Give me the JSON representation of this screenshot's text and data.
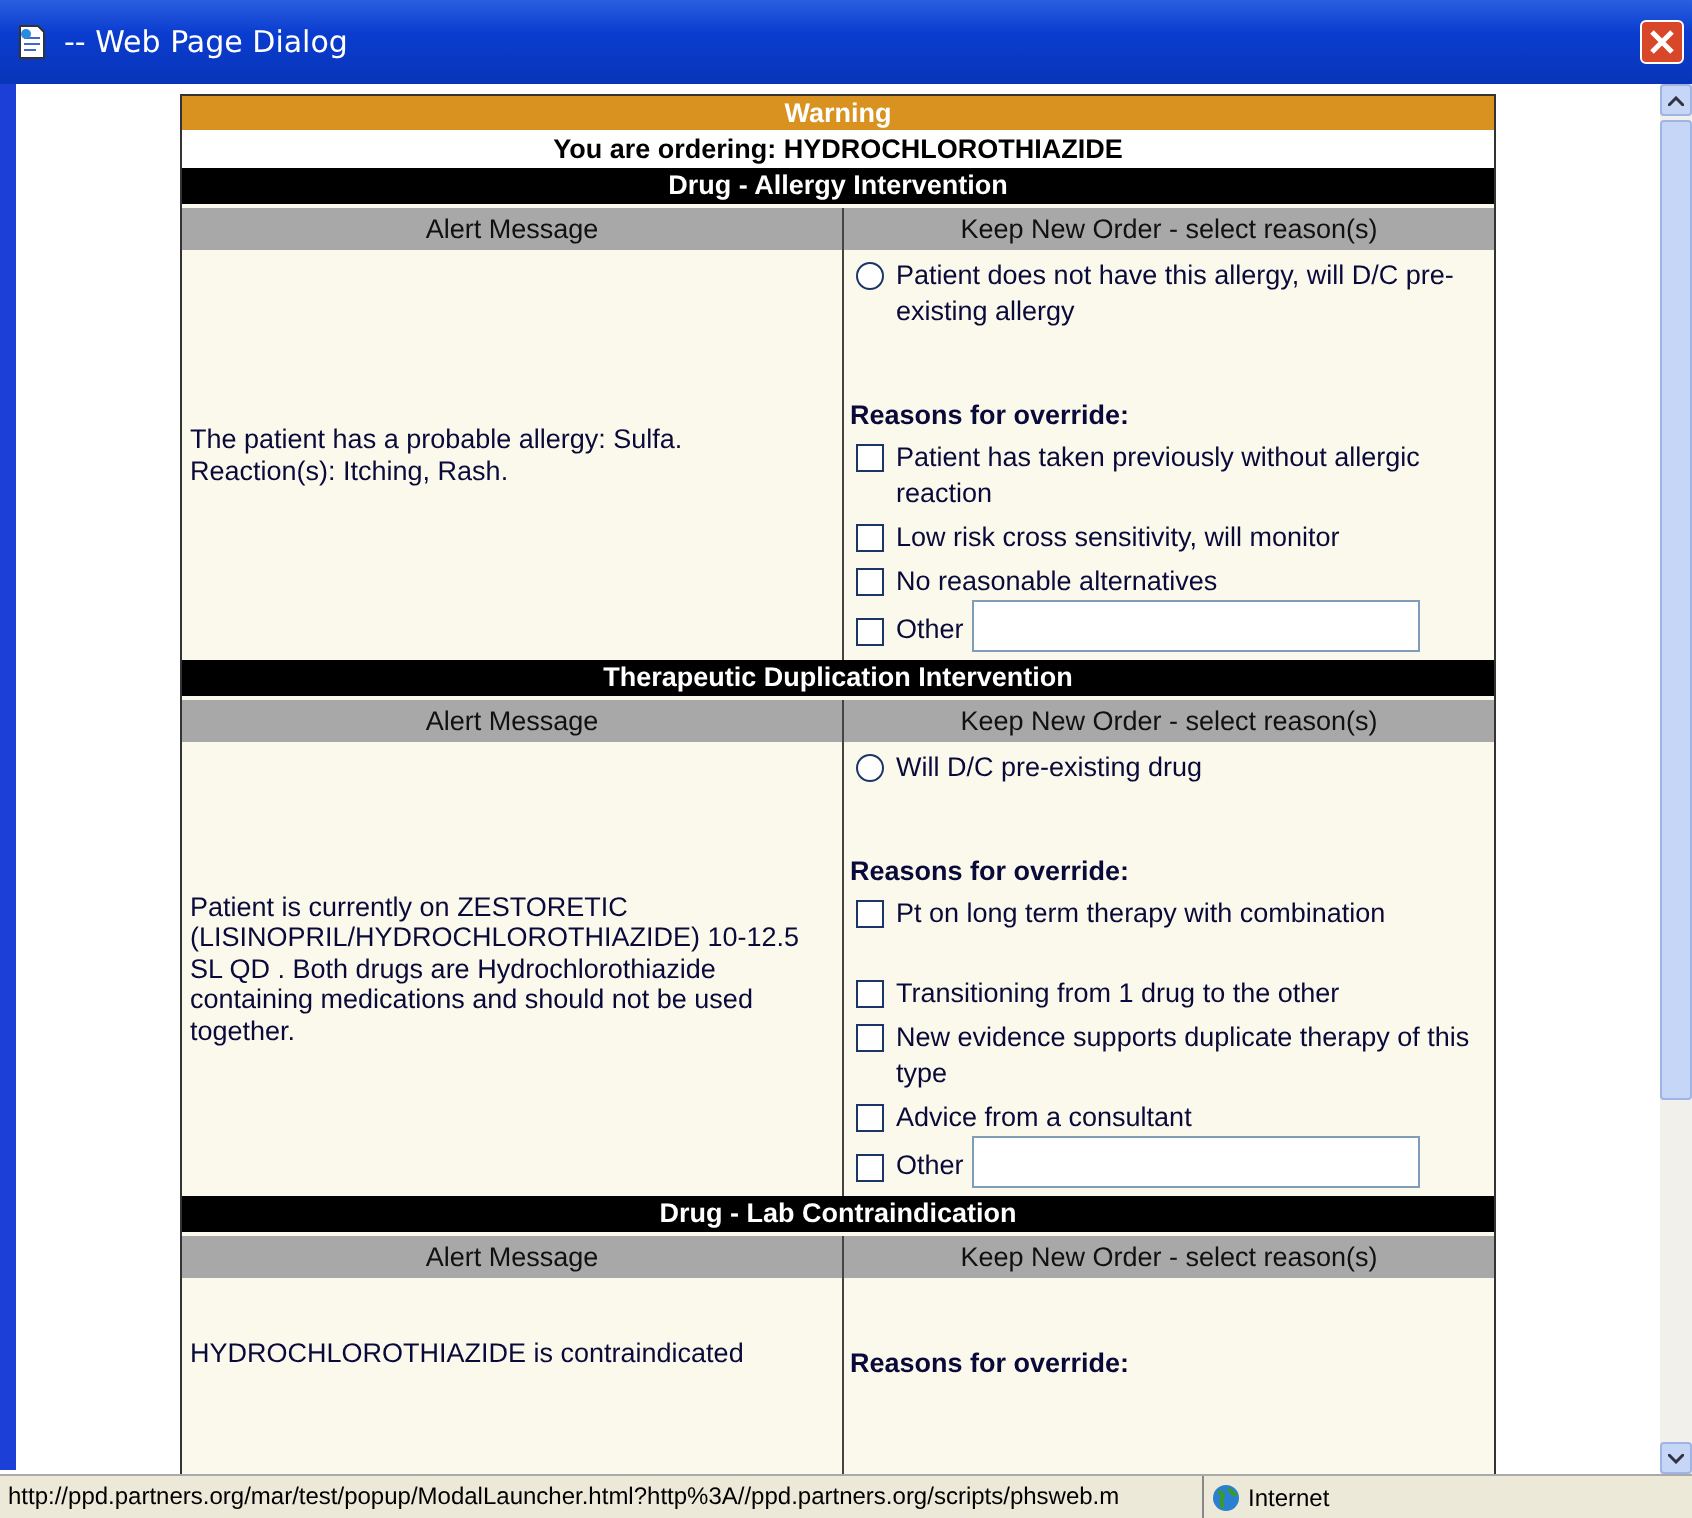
{
  "window": {
    "title": "-- Web Page Dialog"
  },
  "banner": {
    "title": "Warning",
    "ordering": "You are ordering: HYDROCHLOROTHIAZIDE"
  },
  "sections": [
    {
      "title": "Drug - Allergy Intervention",
      "columns": [
        "Alert Message",
        "Keep New Order - select reason(s)"
      ],
      "message": "The patient has a probable allergy: Sulfa. Reaction(s): Itching, Rash.",
      "radio": {
        "label": "Patient does not have this allergy, will D/C pre-existing allergy",
        "selected": false
      },
      "override_heading": "Reasons for override:",
      "reasons": [
        {
          "kind": "plain",
          "label": "Patient has taken previously without allergic reaction",
          "checked": false
        },
        {
          "kind": "plain",
          "label": "Low risk cross sensitivity, will monitor",
          "checked": false
        },
        {
          "kind": "plain",
          "label": "No reasonable alternatives",
          "checked": false
        },
        {
          "kind": "with_field",
          "label": "Other",
          "checked": false
        }
      ]
    },
    {
      "title": "Therapeutic Duplication Intervention",
      "columns": [
        "Alert Message",
        "Keep New Order - select reason(s)"
      ],
      "message": "Patient is currently on ZESTORETIC (LISINOPRIL/HYDROCHLOROTHIAZIDE) 10-12.5 SL QD . Both drugs are Hydrochlorothiazide containing medications and should not be used together.",
      "radio": {
        "label": "Will D/C pre-existing drug",
        "selected": false
      },
      "override_heading": "Reasons for override:",
      "reasons": [
        {
          "kind": "spaced",
          "label": "Pt on long term therapy with combination",
          "checked": false
        },
        {
          "kind": "plain",
          "label": "Transitioning from 1 drug to the other",
          "checked": false
        },
        {
          "kind": "plain",
          "label": "New evidence supports duplicate therapy of this type",
          "checked": false
        },
        {
          "kind": "plain",
          "label": "Advice from a consultant",
          "checked": false
        },
        {
          "kind": "with_field",
          "label": "Other",
          "checked": false
        }
      ]
    },
    {
      "title": "Drug - Lab Contraindication",
      "columns": [
        "Alert Message",
        "Keep New Order - select reason(s)"
      ],
      "message": "HYDROCHLOROTHIAZIDE is contraindicated",
      "override_heading": "Reasons for override:"
    }
  ],
  "status_bar": {
    "url": "http://ppd.partners.org/mar/test/popup/ModalLauncher.html?http%3A//ppd.partners.org/scripts/phsweb.m",
    "zone": "Internet"
  }
}
